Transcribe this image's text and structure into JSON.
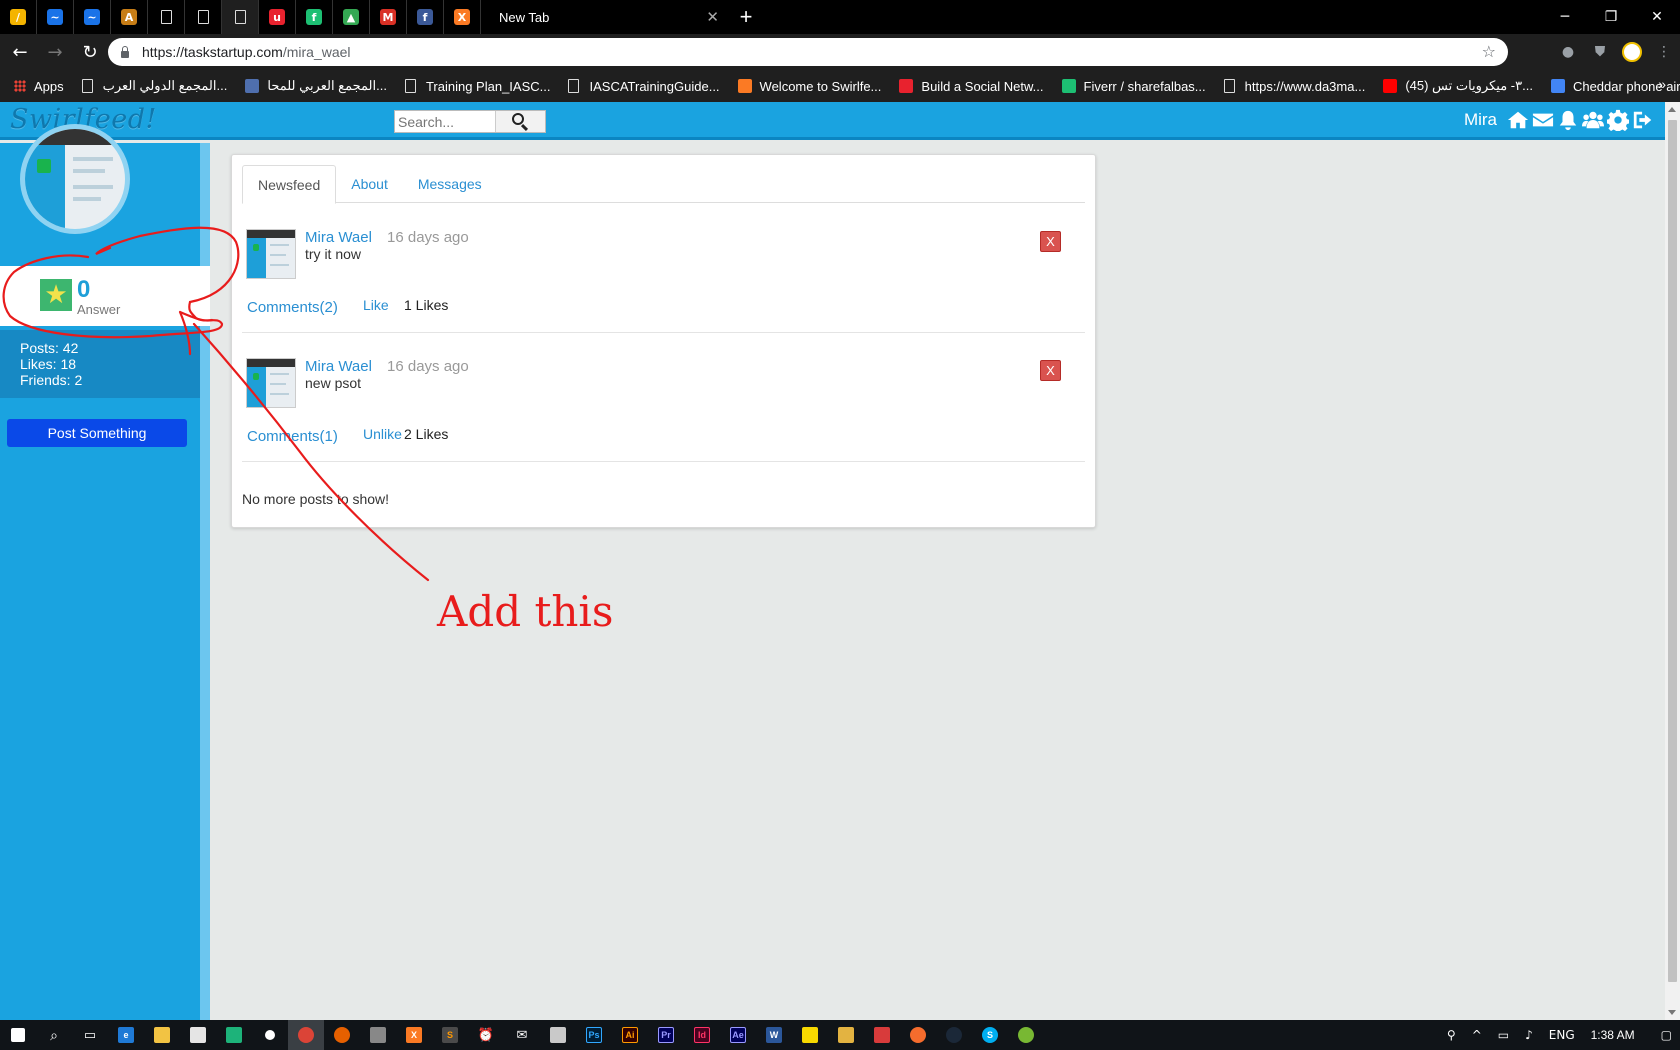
{
  "browser": {
    "active_tab_title": "New Tab",
    "url_host": "https://taskstartup.com",
    "url_path": "/mira_wael",
    "pinned_tabs": [
      {
        "icon": "google-ads-icon",
        "color": "#f4b400",
        "glyph": "/"
      },
      {
        "icon": "hand-icon",
        "color": "#1a73e8",
        "glyph": "~"
      },
      {
        "icon": "hand-icon",
        "color": "#1a73e8",
        "glyph": "~"
      },
      {
        "icon": "arabic-site-icon",
        "color": "#c77d16",
        "glyph": "A"
      },
      {
        "icon": "document-icon",
        "color": "#555555",
        "glyph": ""
      },
      {
        "icon": "document-icon",
        "color": "#555555",
        "glyph": ""
      },
      {
        "icon": "document-icon",
        "color": "#555555",
        "glyph": ""
      },
      {
        "icon": "udemy-icon",
        "color": "#e8222e",
        "glyph": "u"
      },
      {
        "icon": "fiverr-icon",
        "color": "#1dbf73",
        "glyph": "f"
      },
      {
        "icon": "google-drive-icon",
        "color": "#34a853",
        "glyph": "▲"
      },
      {
        "icon": "gmail-icon",
        "color": "#d93025",
        "glyph": "M"
      },
      {
        "icon": "facebook-icon",
        "color": "#3b5998",
        "glyph": "f"
      },
      {
        "icon": "xampp-icon",
        "color": "#fb7a24",
        "glyph": "X"
      }
    ],
    "bookmarks": [
      {
        "label": "Apps",
        "icon": "apps-icon",
        "color": "#e94235"
      },
      {
        "label": "المجمع الدولي العرب...",
        "icon": "document-icon",
        "color": "#ffffff"
      },
      {
        "label": "المجمع العربي للمحا...",
        "icon": "globe-icon",
        "color": "#4f6fae"
      },
      {
        "label": "Training Plan_IASC...",
        "icon": "document-icon",
        "color": "#ffffff"
      },
      {
        "label": "IASCATrainingGuide...",
        "icon": "document-icon",
        "color": "#ffffff"
      },
      {
        "label": "Welcome to Swirlfe...",
        "icon": "xampp-icon",
        "color": "#fb7a24"
      },
      {
        "label": "Build a Social Netw...",
        "icon": "udemy-icon",
        "color": "#e8222e"
      },
      {
        "label": "Fiverr / sharefalbas...",
        "icon": "fiverr-icon",
        "color": "#1dbf73"
      },
      {
        "label": "https://www.da3ma...",
        "icon": "document-icon",
        "color": "#ffffff"
      },
      {
        "label": "(45) ٣- ميكرويات تس...",
        "icon": "youtube-icon",
        "color": "#ff0000"
      },
      {
        "label": "Cheddar phone air...",
        "icon": "google-icon",
        "color": "#4285f4"
      }
    ]
  },
  "site": {
    "logo": "Swirlfeed!",
    "search_placeholder": "Search...",
    "user_name": "Mira",
    "nav_icons": [
      "home-icon",
      "envelope-icon",
      "bell-icon",
      "users-icon",
      "gear-icon",
      "logout-icon"
    ]
  },
  "sidebar": {
    "answer_count": "0",
    "answer_label": "Answer",
    "posts": "Posts: 42",
    "likes": "Likes: 18",
    "friends": "Friends: 2",
    "post_button": "Post Something"
  },
  "feed": {
    "tabs": [
      "Newsfeed",
      "About",
      "Messages"
    ],
    "posts": [
      {
        "author": "Mira Wael",
        "time": "16 days ago",
        "body": "try it now",
        "comments": "Comments(2)",
        "like_action": "Like",
        "likes": "1 Likes",
        "delete": "X"
      },
      {
        "author": "Mira Wael",
        "time": "16 days ago",
        "body": "new psot",
        "comments": "Comments(1)",
        "like_action": "Unlike",
        "likes": "2 Likes",
        "delete": "X"
      }
    ],
    "no_more": "No more posts to show!"
  },
  "annotation": {
    "text": "Add this",
    "color": "#e81c1c"
  },
  "taskbar": {
    "language": "ENG",
    "clock": "1:38 AM"
  }
}
